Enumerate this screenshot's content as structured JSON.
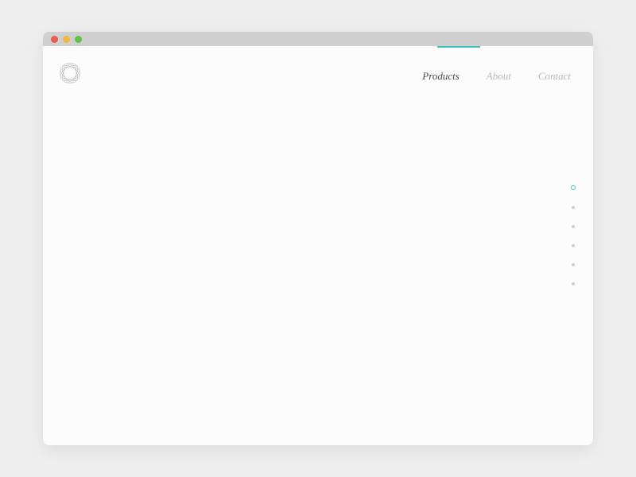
{
  "nav": {
    "items": [
      {
        "label": "Products",
        "active": true
      },
      {
        "label": "About",
        "active": false
      },
      {
        "label": "Contact",
        "active": false
      }
    ]
  },
  "colors": {
    "accent": "#3fc7bd"
  },
  "pageIndicator": {
    "count": 6,
    "activeIndex": 0
  }
}
